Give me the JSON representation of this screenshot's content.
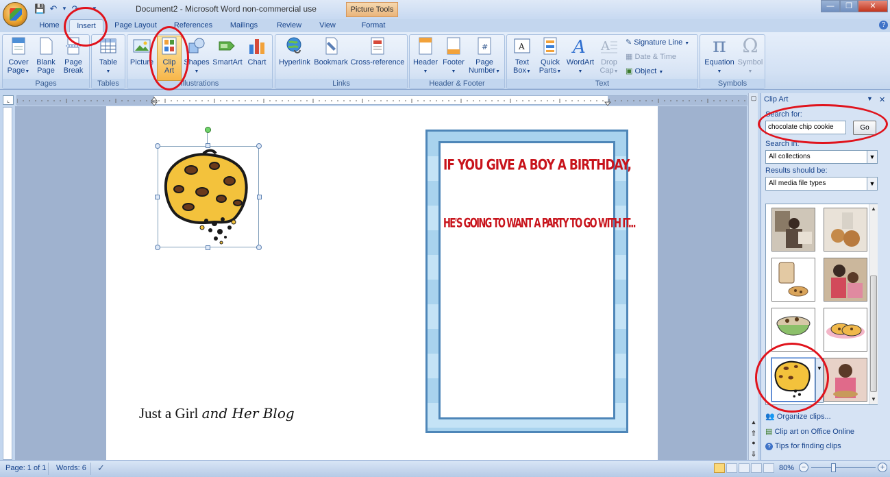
{
  "window": {
    "title": "Document2 - Microsoft Word non-commercial use",
    "contextual_tab": "Picture Tools"
  },
  "tabs": [
    {
      "label": "Home"
    },
    {
      "label": "Insert"
    },
    {
      "label": "Page Layout"
    },
    {
      "label": "References"
    },
    {
      "label": "Mailings"
    },
    {
      "label": "Review"
    },
    {
      "label": "View"
    },
    {
      "label": "Format"
    }
  ],
  "ribbon": {
    "groups": {
      "pages": "Pages",
      "tables": "Tables",
      "illustrations": "Illustrations",
      "links": "Links",
      "header_footer": "Header & Footer",
      "text": "Text",
      "symbols": "Symbols"
    },
    "buttons": {
      "cover_page_1": "Cover",
      "cover_page_2": "Page",
      "blank_page_1": "Blank",
      "blank_page_2": "Page",
      "page_break_1": "Page",
      "page_break_2": "Break",
      "table": "Table",
      "picture": "Picture",
      "clip_art_1": "Clip",
      "clip_art_2": "Art",
      "shapes": "Shapes",
      "smartart": "SmartArt",
      "chart": "Chart",
      "hyperlink": "Hyperlink",
      "bookmark": "Bookmark",
      "cross_reference": "Cross-reference",
      "header": "Header",
      "footer": "Footer",
      "page_number_1": "Page",
      "page_number_2": "Number",
      "text_box_1": "Text",
      "text_box_2": "Box",
      "quick_parts_1": "Quick",
      "quick_parts_2": "Parts",
      "wordart": "WordArt",
      "drop_cap_1": "Drop",
      "drop_cap_2": "Cap",
      "signature_line": "Signature Line",
      "date_time": "Date & Time",
      "object": "Object",
      "equation": "Equation",
      "symbol": "Symbol"
    }
  },
  "document": {
    "card_line1": "IF YOU GIVE A BOY A BIRTHDAY,",
    "card_line2": "HE'S GOING TO WANT A PARTY TO GO WITH IT...",
    "watermark_a": "Just a Girl",
    "watermark_b": "and Her Blog"
  },
  "clip_art_pane": {
    "title": "Clip Art",
    "search_label": "Search for:",
    "search_value": "chocolate chip cookie",
    "go_label": "Go",
    "search_in_label": "Search in:",
    "search_in_value": "All collections",
    "results_label": "Results should be:",
    "results_value": "All media file types",
    "links": {
      "organize": "Organize clips...",
      "office_online": "Clip art on Office Online",
      "tips": "Tips for finding clips"
    }
  },
  "status_bar": {
    "page": "Page: 1 of 1",
    "words": "Words: 6",
    "zoom": "80%"
  },
  "colors": {
    "highlight_circle": "#e0131c",
    "card_text": "#c8141c",
    "card_border": "#4e86b8",
    "card_fill": "#a9d3ee"
  }
}
